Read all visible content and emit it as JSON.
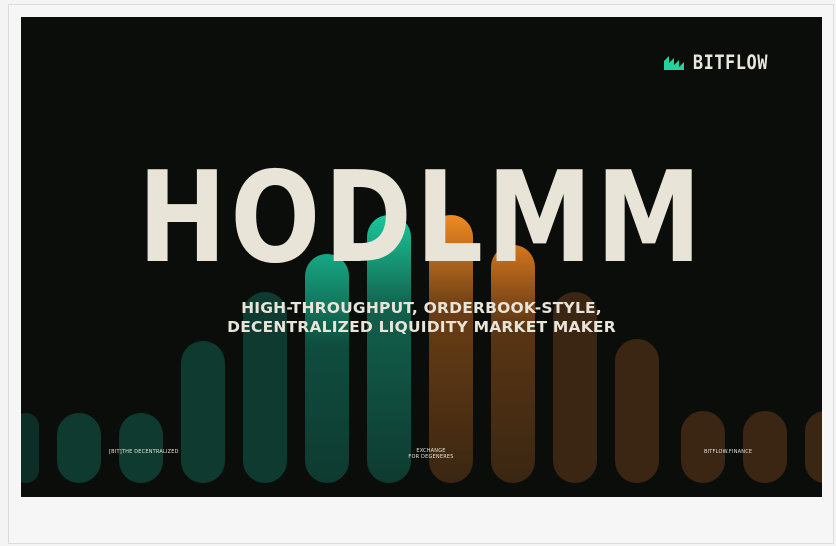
{
  "banner": {
    "brand": "BITFLOW",
    "title": "HODLMM",
    "subtitle_line1": "HIGH-THROUGHPUT, ORDERBOOK-STYLE,",
    "subtitle_line2": "DECENTRALIZED LIQUIDITY MARKET MAKER",
    "footer_left": "[BIT]THE DECENTRALIZED",
    "footer_center_line1": "EXCHANGE",
    "footer_center_line2": "FOR DEGENERES",
    "footer_right": "BITFLOW.FINANCE"
  },
  "colors": {
    "background": "#0b0d0b",
    "text": "#e8e4d8",
    "teal_dim": "#0f3a30",
    "teal_bright": "#1ac79a",
    "orange_dim": "#3a2612",
    "orange_bright": "#f08a22",
    "brand_accent": "#22d39c"
  },
  "icons": {
    "logo": "bitflow-logo-icon"
  }
}
